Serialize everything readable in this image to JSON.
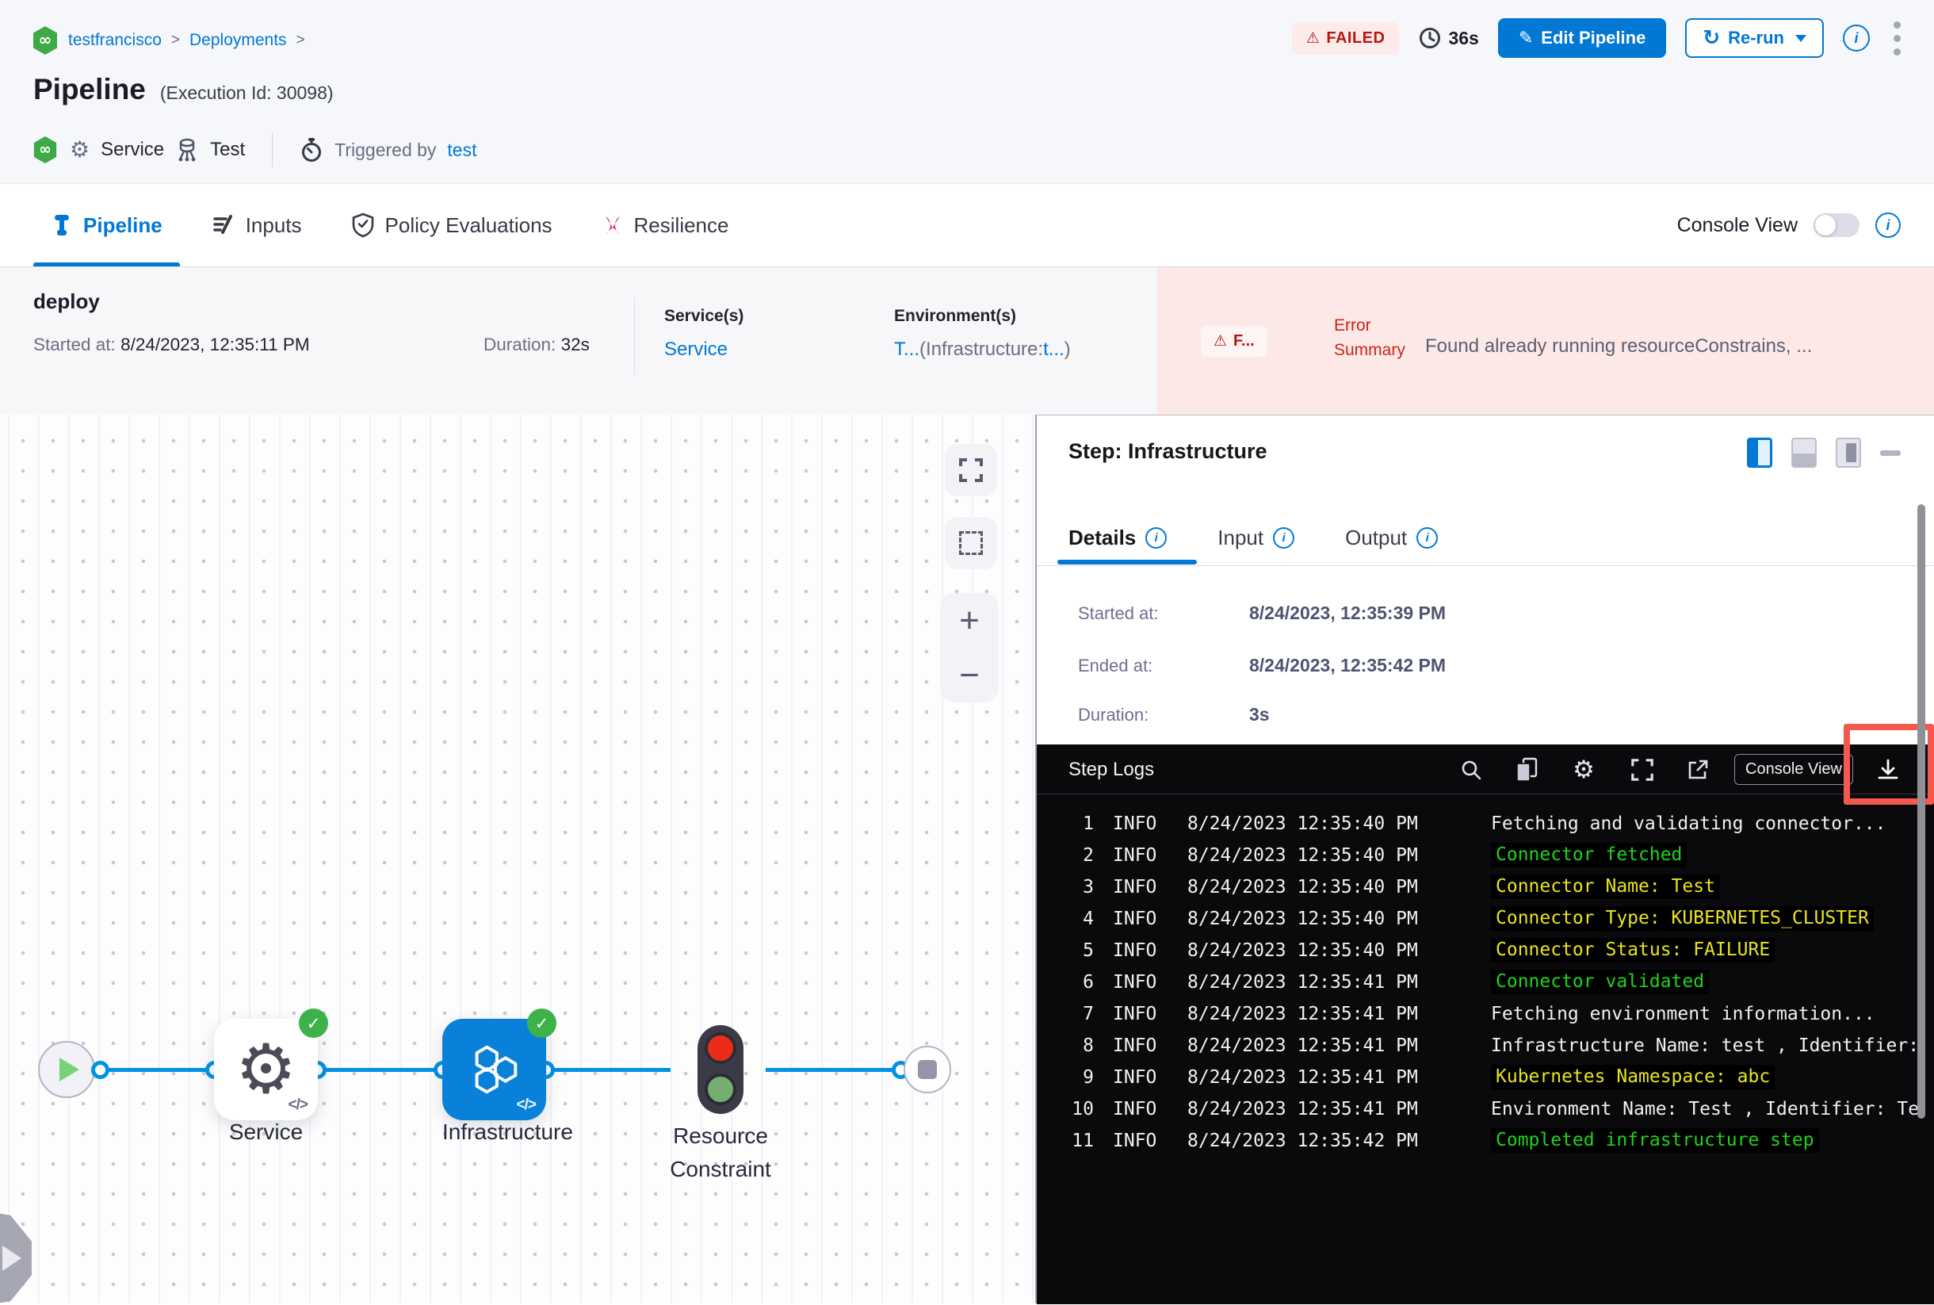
{
  "breadcrumb": {
    "project": "testfrancisco",
    "section": "Deployments",
    "sep": ">"
  },
  "header": {
    "title": "Pipeline",
    "execution_id": "(Execution Id: 30098)",
    "status": "FAILED",
    "elapsed": "36s",
    "edit_pipeline": "Edit Pipeline",
    "rerun": "Re-run",
    "service": "Service",
    "test": "Test",
    "triggered_by": "Triggered by",
    "triggered_by_user": "test"
  },
  "tabs": {
    "pipeline": "Pipeline",
    "inputs": "Inputs",
    "policy": "Policy Evaluations",
    "resilience": "Resilience",
    "console_view": "Console View"
  },
  "stage": {
    "name": "deploy",
    "started_label": "Started at:",
    "started": "8/24/2023, 12:35:11 PM",
    "duration_label": "Duration:",
    "duration": "32s",
    "services_label": "Service(s)",
    "services": "Service",
    "environments_label": "Environment(s)",
    "env_link1": "T...",
    "env_mid": "(Infrastructure:",
    "env_link2": "t...",
    "env_end": ")",
    "error_badge": "F...",
    "error_summary_label": "Error Summary",
    "error_message": "Found already running resourceConstrains, ..."
  },
  "graph": {
    "node1": "Service",
    "node2": "Infrastructure",
    "node3": "Resource Constraint",
    "code_glyph": "</>",
    "zoom_in": "+",
    "zoom_out": "−"
  },
  "panel": {
    "title": "Step: Infrastructure",
    "tab_details": "Details",
    "tab_input": "Input",
    "tab_output": "Output",
    "rows": [
      {
        "label": "Started at:",
        "value": "8/24/2023, 12:35:39 PM"
      },
      {
        "label": "Ended at:",
        "value": "8/24/2023, 12:35:42 PM"
      },
      {
        "label": "Duration:",
        "value": "3s"
      }
    ]
  },
  "logs": {
    "title": "Step Logs",
    "console_view": "Console View",
    "lines": [
      {
        "num": "1",
        "level": "INFO",
        "time": "8/24/2023 12:35:40 PM",
        "msg": "Fetching and validating connector...",
        "color": "white"
      },
      {
        "num": "2",
        "level": "INFO",
        "time": "8/24/2023 12:35:40 PM",
        "msg": "Connector fetched",
        "color": "green"
      },
      {
        "num": "3",
        "level": "INFO",
        "time": "8/24/2023 12:35:40 PM",
        "msg": "Connector Name: Test",
        "color": "yellow"
      },
      {
        "num": "4",
        "level": "INFO",
        "time": "8/24/2023 12:35:40 PM",
        "msg": "Connector Type: KUBERNETES_CLUSTER",
        "color": "yellow"
      },
      {
        "num": "5",
        "level": "INFO",
        "time": "8/24/2023 12:35:40 PM",
        "msg": "Connector Status: FAILURE",
        "color": "yellow"
      },
      {
        "num": "6",
        "level": "INFO",
        "time": "8/24/2023 12:35:41 PM",
        "msg": "Connector validated",
        "color": "green"
      },
      {
        "num": "7",
        "level": "INFO",
        "time": "8/24/2023 12:35:41 PM",
        "msg": "Fetching environment information...",
        "color": "white"
      },
      {
        "num": "8",
        "level": "INFO",
        "time": "8/24/2023 12:35:41 PM",
        "msg": "Infrastructure Name: test , Identifier:",
        "color": "white"
      },
      {
        "num": "9",
        "level": "INFO",
        "time": "8/24/2023 12:35:41 PM",
        "msg": "Kubernetes Namespace: abc",
        "color": "yellow"
      },
      {
        "num": "10",
        "level": "INFO",
        "time": "8/24/2023 12:35:41 PM",
        "msg": "Environment Name: Test , Identifier: Te",
        "color": "white"
      },
      {
        "num": "11",
        "level": "INFO",
        "time": "8/24/2023 12:35:42 PM",
        "msg": "Completed infrastructure step",
        "color": "green"
      }
    ]
  },
  "colors": {
    "accent": "#0278d5",
    "failed_red": "#b41710",
    "success_green": "#3db24a",
    "highlight_red": "#f4594e",
    "log_green": "#1ed41a",
    "log_yellow": "#e9e41f"
  }
}
